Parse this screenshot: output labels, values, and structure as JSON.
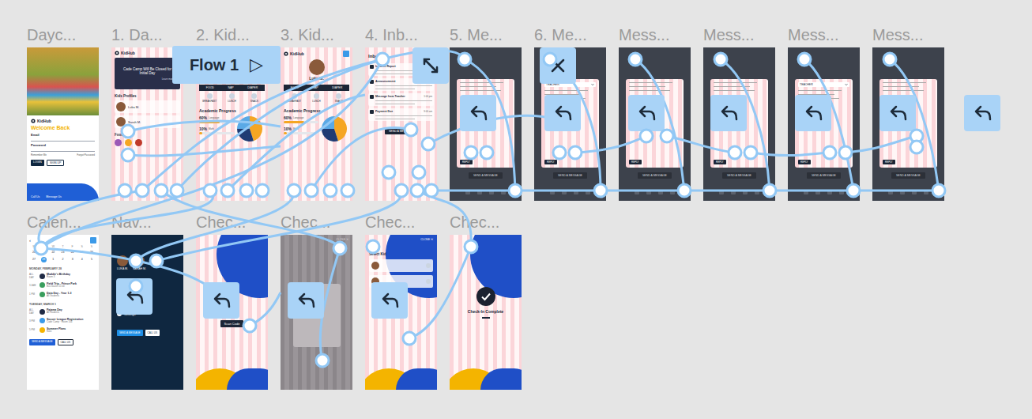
{
  "flow": {
    "label": "Flow 1",
    "icon": "▷"
  },
  "rows": [
    [
      {
        "title": "Dayc...",
        "kind": "login",
        "logo": "KidHub",
        "heading": "Welcome Back",
        "fields": [
          "Email",
          "Password"
        ],
        "links": [
          "Remember Me",
          "Forgot Password"
        ],
        "buttons": [
          "LOGIN",
          "SIGN UP"
        ],
        "footer": [
          "Call Us",
          "Message Us"
        ]
      },
      {
        "title": "1. Da...",
        "kind": "dashboard",
        "logo": "KidHub",
        "banner": "Cade Camp Will Be Closed for Initial Day",
        "banner_link": "Learn more",
        "sections": [
          "Kids Profiles",
          "Food Log"
        ],
        "kids": [
          "Luka M.",
          "Sarah M."
        ]
      },
      {
        "title": "2. Kid...",
        "kind": "kid",
        "logo": "KidHub",
        "name": "Luka M.",
        "tabs": [
          "FOOD",
          "NAP",
          "DIAPER"
        ],
        "meals": [
          "BREAKFAST",
          "LUNCH",
          "SNACK"
        ],
        "section": "Academic Progress",
        "bars": [
          {
            "label": "Language",
            "reading": "60%",
            "level": 0.6
          },
          {
            "label": "Math",
            "reading": "10%",
            "level": 0.1
          }
        ],
        "pie": [
          {
            "value": 45,
            "color": "#f5a623"
          },
          {
            "value": 30,
            "color": "#1f3b73"
          },
          {
            "value": 25,
            "color": "#5aa9e6"
          }
        ]
      },
      {
        "title": "3. Kid...",
        "kind": "kid",
        "logo": "KidHub",
        "name": "Luka M.",
        "tabs": [
          "FOOD",
          "NAP",
          "DIAPER"
        ],
        "meals": [
          "BREAKFAST",
          "LUNCH",
          "SNACK"
        ],
        "section": "Academic Progress",
        "bars": [
          {
            "label": "Language",
            "reading": "60%",
            "level": 0.6
          },
          {
            "label": "Math",
            "reading": "10%",
            "level": 0.1
          }
        ],
        "pie": [
          {
            "value": 45,
            "color": "#f5a623"
          },
          {
            "value": 30,
            "color": "#1f3b73"
          },
          {
            "value": 25,
            "color": "#5aa9e6"
          }
        ]
      },
      {
        "title": "4. Inb...",
        "kind": "inbox",
        "heading": "Inbox",
        "items": [
          {
            "title": "Incident Report",
            "time": "1:30 pm"
          },
          {
            "title": "Announcement",
            "time": "1:20 pm"
          },
          {
            "title": "Message from Teacher",
            "time": "1:00 pm"
          },
          {
            "title": "Payment Due",
            "time": "9:00 am"
          }
        ],
        "button": "SEND A MESSAGE"
      },
      {
        "title": "5. Me...",
        "kind": "message",
        "reply": "REPLY",
        "button": "SEND A MESSAGE"
      },
      {
        "title": "6. Me...",
        "kind": "message",
        "card_title": "TEACHER",
        "reply": "REPLY",
        "button": "SEND A MESSAGE"
      },
      {
        "title": "Mess...",
        "kind": "message",
        "reply": "REPLY",
        "button": "SEND A MESSAGE"
      },
      {
        "title": "Mess...",
        "kind": "message",
        "reply": "REPLY",
        "button": "SEND A MESSAGE"
      },
      {
        "title": "Mess...",
        "kind": "message",
        "card_title": "TEACHER",
        "reply": "REPLY",
        "button": "SEND A MESSAGE"
      },
      {
        "title": "Mess...",
        "kind": "message",
        "reply": "REPLY",
        "button": "SEND A MESSAGE"
      }
    ],
    [
      {
        "title": "Calen...",
        "kind": "calendar",
        "nav": "‹",
        "weekdays": [
          "M",
          "T",
          "W",
          "T",
          "F",
          "S",
          "S"
        ],
        "days": [
          {
            "label": "20",
            "selected": false
          },
          {
            "label": "21",
            "selected": false
          },
          {
            "label": "22",
            "selected": false
          },
          {
            "label": "23",
            "selected": false
          },
          {
            "label": "24",
            "selected": false
          },
          {
            "label": "25",
            "selected": false
          },
          {
            "label": "26",
            "selected": false
          },
          {
            "label": "27",
            "selected": false
          },
          {
            "label": "28",
            "selected": true
          },
          {
            "label": "1",
            "selected": false
          },
          {
            "label": "2",
            "selected": false
          },
          {
            "label": "3",
            "selected": false
          },
          {
            "label": "4",
            "selected": false
          },
          {
            "label": "5",
            "selected": false
          }
        ],
        "agenda": [
          {
            "heading": "MONDAY, FEBRUARY 28",
            "events": [
              {
                "time": "ALL DAY",
                "title": "Maddie's Birthday",
                "sub": "Room 3",
                "color": "#1f2a44"
              },
              {
                "time": "11 AM",
                "title": "Field Trip - Prince Park",
                "sub": "Bus leaves 11:00",
                "color": "#3a9d5d"
              },
              {
                "time": "1 PM",
                "title": "Data Day - Year 1-3",
                "sub": "All Students",
                "color": "#3a9d5d"
              }
            ]
          },
          {
            "heading": "TUESDAY, MARCH 1",
            "events": [
              {
                "time": "ALL DAY",
                "title": "Pajama Day",
                "sub": "All Students",
                "color": "#1f2a44"
              },
              {
                "time": "3 PM",
                "title": "Soccer League Registration",
                "sub": "Cade Camp · Room 104",
                "color": "#3b9ae8"
              },
              {
                "time": "5 PM",
                "title": "Summer Plans",
                "sub": "Note",
                "color": "#f5b400"
              }
            ]
          }
        ],
        "buttons": [
          "SEND A MESSAGE",
          "CALL US"
        ]
      },
      {
        "title": "Nav...",
        "kind": "nav",
        "kids": [
          "LUKA M.",
          "SARAH M."
        ],
        "items": [
          "Check-In / Out",
          "Billing",
          "Settings"
        ],
        "buttons": [
          "SEND A MESSAGE",
          "CALL US"
        ]
      },
      {
        "title": "Chec...",
        "kind": "check",
        "variant": "scan",
        "button": "Scan Code"
      },
      {
        "title": "Chec...",
        "kind": "check",
        "variant": "overlay",
        "close": "CLOSE ✕"
      },
      {
        "title": "Chec...",
        "kind": "check",
        "variant": "select",
        "close": "CLOSE ✕",
        "heading": "Select Kid"
      },
      {
        "title": "Chec...",
        "kind": "check",
        "variant": "complete",
        "heading": "Check-In Complete"
      }
    ]
  ]
}
